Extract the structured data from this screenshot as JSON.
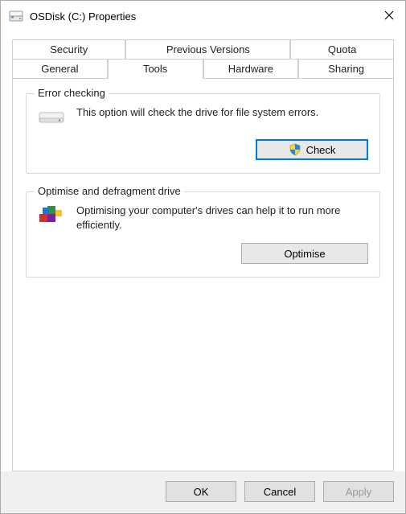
{
  "title": "OSDisk (C:) Properties",
  "tabs_row1": [
    "Security",
    "Previous Versions",
    "Quota"
  ],
  "tabs_row2": [
    "General",
    "Tools",
    "Hardware",
    "Sharing"
  ],
  "active_tab": "Tools",
  "group1": {
    "label": "Error checking",
    "text": "This option will check the drive for file system errors.",
    "button": "Check"
  },
  "group2": {
    "label": "Optimise and defragment drive",
    "text": "Optimising your computer's drives can help it to run more efficiently.",
    "button": "Optimise"
  },
  "footer": {
    "ok": "OK",
    "cancel": "Cancel",
    "apply": "Apply"
  }
}
